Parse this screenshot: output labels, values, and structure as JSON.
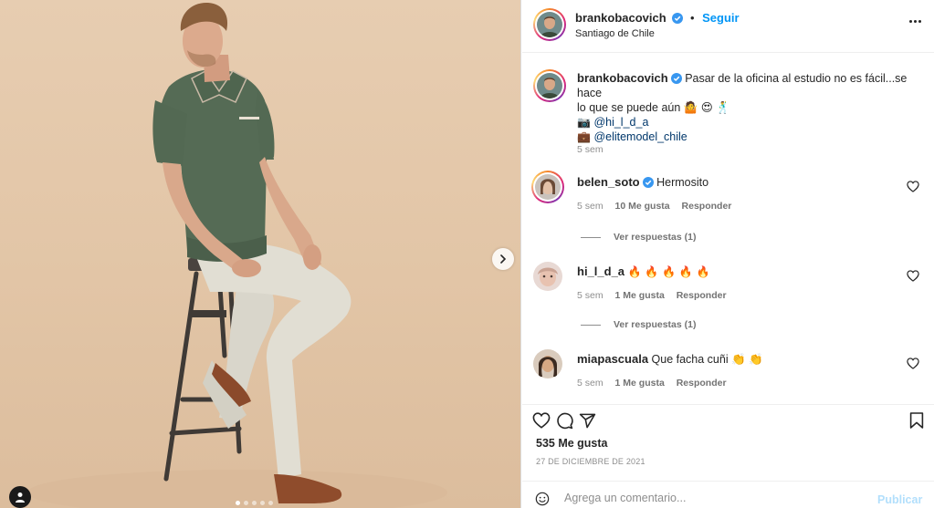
{
  "post": {
    "author": "brankobacovich",
    "location": "Santiago de Chile",
    "follow_label": "Seguir",
    "separator": "•",
    "carousel": {
      "total_slides": 5,
      "active_slide": 1
    },
    "icons": {
      "next": "chevron-right-icon",
      "tagged": "user-tag-icon",
      "more": "more-options-icon",
      "verified": "verified-badge-icon"
    }
  },
  "caption": {
    "username": "brankobacovich",
    "line1": "Pasar de la oficina al estudio no es fácil...se hace",
    "line2": "lo que se puede aún 🤷 😍 🕺",
    "photo_prefix": "📷",
    "photo_credit": "@hi_l_d_a",
    "agency_prefix": "💼",
    "agency": "@elitemodel_chile",
    "time": "5 sem"
  },
  "comments": [
    {
      "username": "belen_soto",
      "verified": true,
      "text": "Hermosito",
      "time": "5 sem",
      "likes": "10 Me gusta",
      "reply_label": "Responder",
      "view_replies": "Ver respuestas (1)"
    },
    {
      "username": "hi_l_d_a",
      "verified": false,
      "text": "🔥 🔥 🔥 🔥 🔥",
      "time": "5 sem",
      "likes": "1 Me gusta",
      "reply_label": "Responder",
      "view_replies": "Ver respuestas (1)"
    },
    {
      "username": "miapascuala",
      "verified": false,
      "text": "Que facha cuñi 👏 👏",
      "time": "5 sem",
      "likes": "1 Me gusta",
      "reply_label": "Responder"
    }
  ],
  "actions": {
    "like_icon": "heart-icon",
    "comment_icon": "comment-icon",
    "share_icon": "share-icon",
    "save_icon": "bookmark-icon",
    "likes_count": "535 Me gusta",
    "date": "27 DE DICIEMBRE DE 2021"
  },
  "add_comment": {
    "placeholder": "Agrega un comentario...",
    "publish_label": "Publicar",
    "emoji_icon": "emoji-icon"
  },
  "colors": {
    "accent": "#0095f6",
    "text": "#262626",
    "muted": "#8e8e8e",
    "publish_disabled": "#b2dffc",
    "photo_background": "#e2c5a6"
  }
}
